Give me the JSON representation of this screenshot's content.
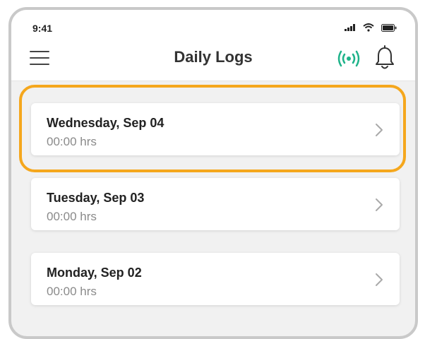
{
  "status_bar": {
    "time": "9:41"
  },
  "header": {
    "title": "Daily Logs",
    "menu_icon": "hamburger-menu-icon",
    "live_icon": "live-signal-icon",
    "notification_icon": "bell-icon"
  },
  "colors": {
    "accent_live": "#1fb38a",
    "highlight": "#f5a71d",
    "text_primary": "#222222",
    "text_secondary": "#8a8a8a"
  },
  "logs": [
    {
      "date": "Wednesday, Sep 04",
      "hours": "00:00 hrs",
      "highlighted": true
    },
    {
      "date": "Tuesday, Sep 03",
      "hours": "00:00 hrs",
      "highlighted": false
    },
    {
      "date": "Monday, Sep 02",
      "hours": "00:00 hrs",
      "highlighted": false
    }
  ]
}
